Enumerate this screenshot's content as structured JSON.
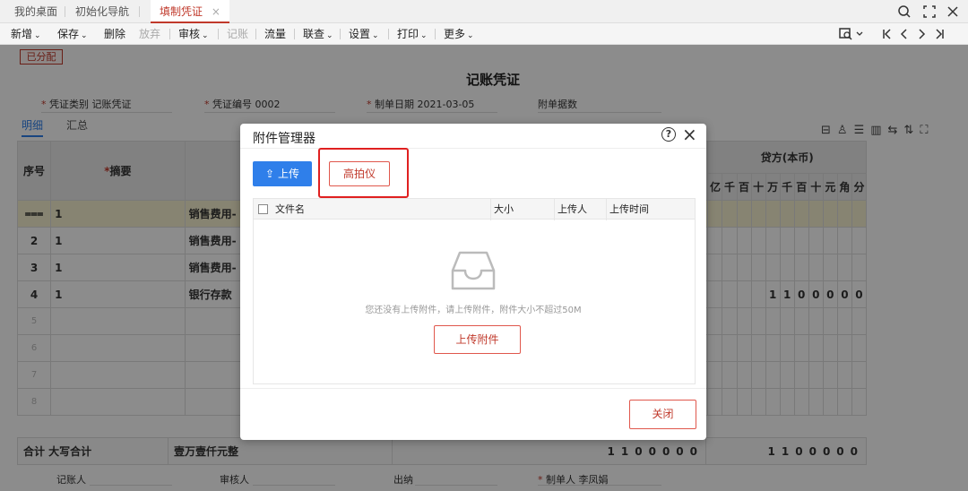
{
  "tabs": [
    {
      "label": "我的桌面"
    },
    {
      "label": "初始化导航"
    },
    {
      "label": "填制凭证",
      "close": "×"
    }
  ],
  "toolbar": {
    "items": [
      {
        "label": "新增",
        "dropdown": true
      },
      {
        "label": "保存",
        "dropdown": true
      },
      {
        "label": "删除"
      },
      {
        "label": "放弃",
        "disabled": true
      },
      {
        "label": "审核",
        "dropdown": true
      },
      {
        "label": "记账",
        "disabled": true
      },
      {
        "label": "流量"
      },
      {
        "label": "联查",
        "dropdown": true
      },
      {
        "label": "设置",
        "dropdown": true
      },
      {
        "label": "打印",
        "dropdown": true
      },
      {
        "label": "更多",
        "dropdown": true
      }
    ],
    "caret": "⌄"
  },
  "voucher": {
    "status_stamp": "已分配",
    "title": "记账凭证",
    "type_label": "凭证类别",
    "type_value": "记账凭证",
    "number_label": "凭证编号",
    "number_value": "0002",
    "date_label": "制单日期",
    "date_value": "2021-03-05",
    "attach_label": "附单据数",
    "required_mark": "*"
  },
  "subtabs": {
    "detail": "明细",
    "summary": "汇总"
  },
  "grid": {
    "col_seq": "序号",
    "col_summary": "摘要",
    "col_credit": "贷方(本币)",
    "digits": [
      "亿",
      "千",
      "百",
      "十",
      "万",
      "千",
      "百",
      "十",
      "元",
      "角",
      "分"
    ],
    "rows": [
      {
        "seq": "1",
        "summary": "1",
        "account": "销售费用-"
      },
      {
        "seq": "2",
        "summary": "1",
        "account": "销售费用-"
      },
      {
        "seq": "3",
        "summary": "1",
        "account": "销售费用-"
      },
      {
        "seq": "4",
        "summary": "1",
        "account": "银行存款",
        "credit": "1100000"
      },
      {
        "seq": "5"
      },
      {
        "seq": "6"
      },
      {
        "seq": "7"
      },
      {
        "seq": "8"
      }
    ],
    "total_label": "合计 大写合计",
    "total_upper": "壹万壹仟元整",
    "total_debit": "1100000",
    "total_credit": "1100000"
  },
  "footer": {
    "bookkeeper": "记账人",
    "auditor": "审核人",
    "cashier": "出纳",
    "maker_label": "制单人",
    "maker_value": "李凤娟"
  },
  "dialog": {
    "title": "附件管理器",
    "help_icon": "?",
    "close_icon": "×",
    "upload_label": "上传",
    "upload_icon": "⇪",
    "scanner_label": "高拍仪",
    "columns": [
      "文件名",
      "大小",
      "上传人",
      "上传时间"
    ],
    "empty_text": "您还没有上传附件，请上传附件，附件大小不超过50M",
    "upload_attachment_label": "上传附件",
    "close_label": "关闭"
  },
  "colors": {
    "accent": "#c0392b",
    "primary": "#2f7fea",
    "highlight": "#e02020"
  }
}
